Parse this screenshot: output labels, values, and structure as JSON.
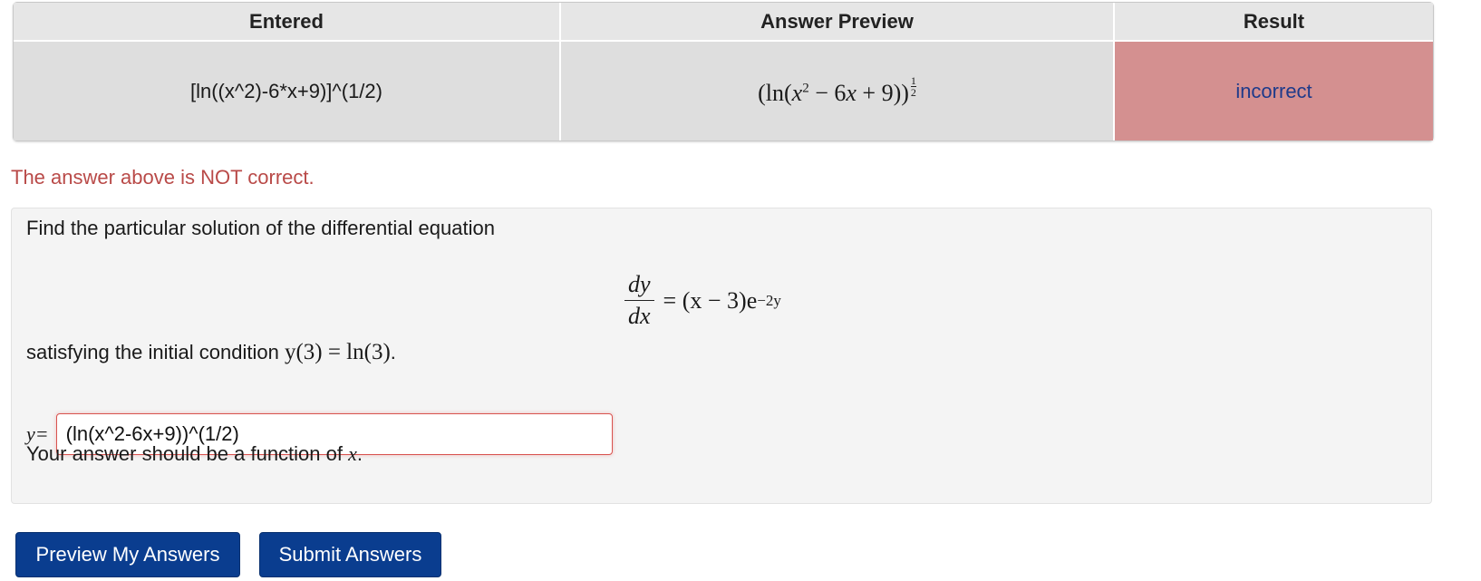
{
  "results_table": {
    "headers": [
      "Entered",
      "Answer Preview",
      "Result"
    ],
    "entered": "[ln((x^2)-6*x+9)]^(1/2)",
    "preview": {
      "lparen_outer": "(",
      "ln": "ln",
      "lparen_inner": "(",
      "x": "x",
      "x_exp": "2",
      "middle": " − 6",
      "x2": "x",
      "tail": " + 9",
      "rparen": "))",
      "exp_num": "1",
      "exp_den": "2"
    },
    "result": "incorrect"
  },
  "feedback_message": "The answer above is NOT correct.",
  "problem": {
    "intro": "Find the particular solution of the differential equation",
    "equation": {
      "num": "dy",
      "den": "dx",
      "rhs": "= (x − 3)e",
      "rhs_exp": "−2y"
    },
    "condition_prefix": "satisfying the initial condition ",
    "condition_math": "y(3) = ln(3)",
    "condition_suffix": ".",
    "answer_label": "y=",
    "answer_value": "(ln(x^2-6x+9))^(1/2)",
    "hint_prefix": "Your answer should be a function of ",
    "hint_var": "x",
    "hint_suffix": "."
  },
  "buttons": {
    "preview": "Preview My Answers",
    "submit": "Submit Answers"
  },
  "colors": {
    "button_bg": "#0a3d8f",
    "incorrect_bg": "#d49090",
    "error_text": "#b94a48"
  }
}
